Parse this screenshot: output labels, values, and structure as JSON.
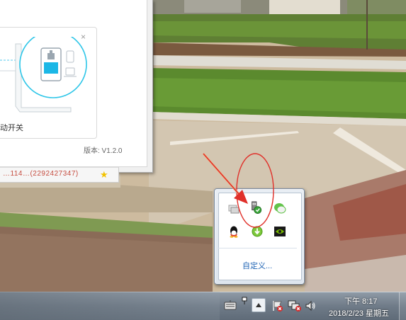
{
  "app_window": {
    "switch_label": "动开关",
    "version_label": "版本: V1.2.0",
    "close_glyph": "×",
    "bottom_strip_text": "…114…(2292427347)"
  },
  "tray_popup": {
    "customize_link": "自定义..."
  },
  "taskbar": {
    "time": "下午 8:17",
    "date": "2018/2/23 星期五"
  },
  "colors": {
    "link": "#1e63b4",
    "annotation_red": "#e0302a",
    "accent_cyan": "#2ec6e8"
  },
  "icons": {
    "tray": [
      "network-icon",
      "usb-safely-remove-icon",
      "wechat-icon",
      "qq-icon",
      "download-icon",
      "nvidia-icon"
    ],
    "taskbar": [
      "keyboard-icon",
      "pen-icon",
      "show-hidden-icons-button",
      "flag-action-center-icon",
      "network-disconnected-icon",
      "volume-icon"
    ]
  }
}
